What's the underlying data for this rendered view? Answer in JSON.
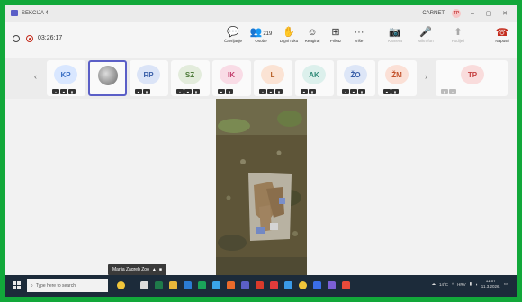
{
  "window": {
    "title": "SEKCIJA 4",
    "org": "CARNET",
    "user_initials": "TP",
    "more_glyph": "···",
    "minimize_glyph": "–",
    "maximize_glyph": "▢",
    "close_glyph": "✕"
  },
  "toolbar": {
    "timer": "03:26:17",
    "people_count": "219",
    "buttons": [
      {
        "label": "Čavrljanje",
        "glyph": "💬"
      },
      {
        "label": "Osobe",
        "glyph": "👥"
      },
      {
        "label": "Digni ruku",
        "glyph": "✋"
      },
      {
        "label": "Reagiraj",
        "glyph": "☺"
      },
      {
        "label": "Prikaz",
        "glyph": "⊞"
      },
      {
        "label": "Više",
        "glyph": "···"
      }
    ],
    "media": [
      {
        "label": "Kamera",
        "glyph": "📷"
      },
      {
        "label": "Mikrofon",
        "glyph": "🎤"
      },
      {
        "label": "Podijeli",
        "glyph": "⬆"
      }
    ],
    "leave_label": "Napusti",
    "leave_glyph": "☎"
  },
  "gallery": {
    "prev_glyph": "‹",
    "next_glyph": "›",
    "tiles": [
      {
        "initials": "KP",
        "bg": "#d9e7ff",
        "fg": "#3b6fc4"
      },
      {
        "initials": "",
        "bg": "",
        "fg": ""
      },
      {
        "initials": "RP",
        "bg": "#dbe4f7",
        "fg": "#3a5fa8"
      },
      {
        "initials": "SZ",
        "bg": "#e3ecdc",
        "fg": "#4e7a3a"
      },
      {
        "initials": "IK",
        "bg": "#f9dce6",
        "fg": "#c23b6b"
      },
      {
        "initials": "L",
        "bg": "#fbe3d4",
        "fg": "#b8612b"
      },
      {
        "initials": "AK",
        "bg": "#dcf0ec",
        "fg": "#2f8a77"
      },
      {
        "initials": "ŽO",
        "bg": "#dde6f7",
        "fg": "#3a5fa8"
      },
      {
        "initials": "ŽM",
        "bg": "#fbe0d6",
        "fg": "#c2512b"
      },
      {
        "initials": "TP",
        "bg": "#f9dcdc",
        "fg": "#c43d3d"
      }
    ]
  },
  "stage": {
    "speaker_name": "Marija Zagreb Zoo"
  },
  "taskbar": {
    "search_placeholder": "Type here to search",
    "weather": "14°C",
    "lang": "HRV",
    "time": "11:07",
    "date": "11.3.2026."
  },
  "colors": {
    "accent": "#5b5fc7",
    "leave": "#c42b1c",
    "border": "#12a83a"
  }
}
